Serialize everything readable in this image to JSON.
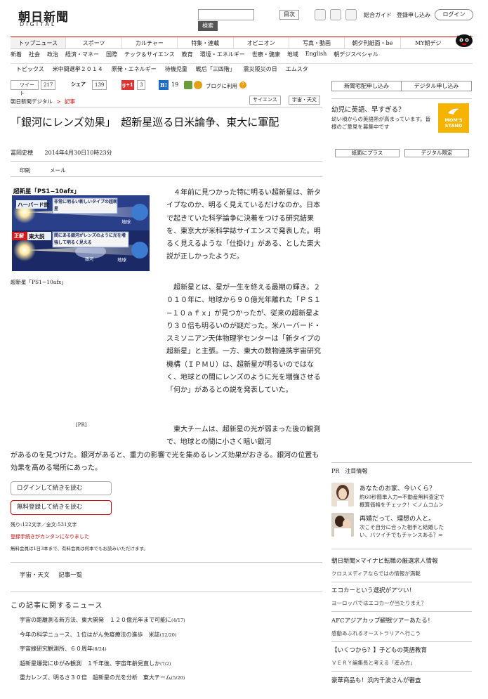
{
  "header": {
    "logo_title": "朝日新聞",
    "logo_sub": "DIGITAL",
    "search_button": "検索",
    "toc_button": "目次",
    "guide_link": "総合ガイド",
    "signup_link": "登録申し込み",
    "login_button": "ログイン"
  },
  "main_nav": [
    "トップニュース",
    "スポーツ",
    "カルチャー",
    "特集・連載",
    "オピニオン",
    "写真・動画",
    "朝夕刊紙面・be",
    "MY朝デジ"
  ],
  "sub_nav": [
    "新着",
    "社会",
    "政治",
    "経済・マネー",
    "国際",
    "テック＆サイエンス",
    "教育",
    "環境・エネルギー",
    "世療・健康",
    "地域",
    "English",
    "朝デジスペシャル"
  ],
  "topics": {
    "label": "トピックス",
    "items": [
      "米中間選挙２０１４",
      "原発・エネルギー",
      "待機児童",
      "戦后「三四階」",
      "震災阪災の日",
      "エムスタ"
    ]
  },
  "share": {
    "tweet_label": "ツイート",
    "tweet_count": "217",
    "share_label": "シェア",
    "share_count": "139",
    "gplus_label": "g+1",
    "gplus_count": "3",
    "hatena_label": "B!",
    "hatena_count": "19",
    "blog_label": "ブログに利用"
  },
  "breadcrumb": {
    "site": "朝日新聞デジタル",
    "separator": ">",
    "current": "記事"
  },
  "tags": [
    "サイエンス",
    "宇宙・天文"
  ],
  "article": {
    "title": "「銀河にレンズ効果」　超新星巡る日米論争、東大に軍配",
    "author": "冨岡史穂",
    "date": "2014年4月30日10時23分",
    "print_label": "印刷",
    "mail_label": "メール",
    "figure_caption": "超新星「PS1−10afx」",
    "figure_labels": {
      "title": "超新星「PS1−10afx」",
      "harvard": "ハーバード説",
      "harvard_text": "非常に明るい新しいタイプの超新星",
      "earth": "地球",
      "correct": "正解",
      "todai": "東大説",
      "todai_text": "間にある銀河がレンズのように光を増強して明るく見える",
      "galaxy": "銀河"
    },
    "pr_label": "[PR]",
    "p1": "４年前に見つかった特に明るい超新星は、新タイプなのか、明るく見えているだけなのか。日本で起きていた科学論争に決着をつける研究結果を、東京大が米科学誌サイエンスで発表した。明るく見えるような「仕掛け」がある、とした東大説が正しかったようだ。",
    "p2": "超新星とは、星が一生を終える最期の輝き。２０１０年に、地球から９０億光年離れた「ＰＳ１−１０ａｆｘ」が見つかったが、従来の超新星より３０倍も明るいのが謎だった。米ハーバード・スミソニアン天体物理学センターは「新タイプの超新星」と主張。一方、東大の数物連携宇宙研究機構（ＩＰＭＵ）は、超新星が明るいのではなく、地球との間にレンズのように光を増強させる「何か」があるとの説を発表していた。",
    "p3a": "東大チームは、超新星の光が弱まった後の観測で、地球との間に小さく暗い銀河",
    "p3b": "があるのを見つけた。銀河があると、重力の影響で光を集めるレンズ効果がおきる。銀河の位置も効果を高める場所にあった。",
    "login_continue": "ログインして続きを読む",
    "free_signup_continue": "無料登録して続きを読む",
    "remaining": "残り:122文字／全文:531文字",
    "notice_red": "登録手続きがカンタンになりました",
    "notice_small": "無料会員は1日3本まで、有料会員は何本でもお読みいただけます。",
    "category_links": [
      "宇宙・天文",
      "記事一覧"
    ]
  },
  "related": {
    "heading": "この記事に関するニュース",
    "items": [
      {
        "text": "宇宙の距離測る新方法、東大開発　１２０億光年まで可能に",
        "date": "(4/17)"
      },
      {
        "text": "今年の科学ニュース、１位はがん免疫療法の進歩　米誌",
        "date": "(12/20)"
      },
      {
        "text": "宇宙線研究観測所、６０周年",
        "date": "(8/24)"
      },
      {
        "text": "超新星爆発にゆがみ観測　１千年後、宇宙年齢見直しか",
        "date": "(7/2)"
      },
      {
        "text": "重力レンズ、明るさ３０倍　超新星の光を分析　東大チーム",
        "date": "(5/20)"
      }
    ]
  },
  "sidebar": {
    "home_delivery": "新聞宅配申し込み",
    "digital_signup": "デジタル申し込み",
    "ad_title": "幼児に英語、早すぎる？",
    "ad_text": "幼い頃からの英語熱が高まっています。皆様のご意見を募集中です",
    "mom_logo_line1": "MOM'S",
    "mom_logo_line2": "STAND",
    "paper_plus": "紙面にプラス",
    "digital_limited": "デジタル限定",
    "pr_heading": "PR　注目情報",
    "pr_items": [
      {
        "title": "あなたのお家、今いくら？",
        "text": "約60秒簡単入力⇒不動産無料査定で概算価格をチェック！＜ノムコム＞"
      },
      {
        "title": "再婚だって、理想の人と。",
        "text": "次こそ自分に合った相手と結婚したい、バツイチでもチャンスある？⇒"
      }
    ],
    "links": [
      {
        "title": "朝日新聞×マイナビ転職の厳選求人情報",
        "sub": "クロスメディアならではの情報が満載"
      },
      {
        "title": "エコカーという選択がアツい！",
        "sub": "ヨーロッパではエコカーが当たりまえ？"
      },
      {
        "title": "AFCアジアカップ観戦ツアーあたる！",
        "sub": "感動あふれるオーストラリアへ行こう"
      },
      {
        "title": "【いくつから？】子どもの英語教育",
        "sub": "ＶＥＲＹ編集長と考える「産み方」"
      },
      {
        "title": "豪華商品も！浜内千波さんが審査",
        "sub": ""
      }
    ]
  },
  "colors": {
    "accent_red": "#cc0000",
    "mom_yellow": "#f5b400",
    "hatena_blue": "#1d6cc3",
    "gplus_red": "#dd3333"
  }
}
